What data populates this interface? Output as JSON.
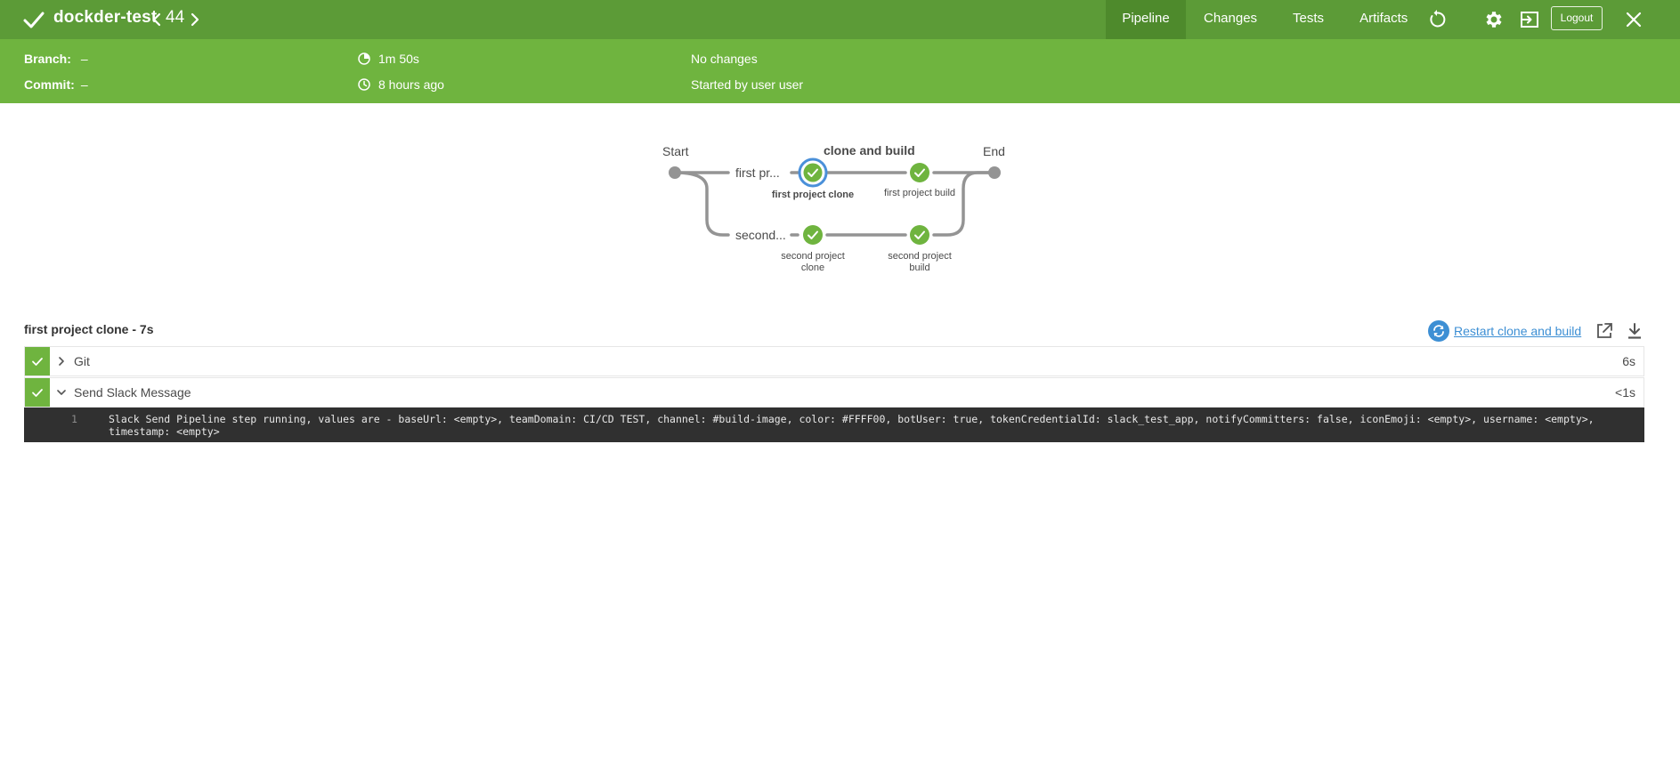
{
  "header": {
    "title": "dockder-test",
    "run_number": "44",
    "tabs": [
      {
        "label": "Pipeline",
        "active": true
      },
      {
        "label": "Changes",
        "active": false
      },
      {
        "label": "Tests",
        "active": false
      },
      {
        "label": "Artifacts",
        "active": false
      }
    ],
    "logout_label": "Logout",
    "colors": {
      "header": "#5c9b37",
      "summary": "#6fb43f",
      "active_tab": "#4e8a2c"
    }
  },
  "summary": {
    "branch_label": "Branch:",
    "branch_value": "–",
    "commit_label": "Commit:",
    "commit_value": "–",
    "duration": "1m 50s",
    "started_ago": "8 hours ago",
    "changes": "No changes",
    "started_by": "Started by user user"
  },
  "graph": {
    "start_label": "Start",
    "end_label": "End",
    "stage_title": "clone and build",
    "branches": [
      {
        "label": "first pr...",
        "steps": [
          {
            "label": "first project clone",
            "selected": true
          },
          {
            "label": "first project build",
            "selected": false
          }
        ]
      },
      {
        "label": "second...",
        "steps": [
          {
            "label": "second project clone",
            "selected": false
          },
          {
            "label": "second project build",
            "selected": false
          }
        ]
      }
    ]
  },
  "detail": {
    "title": "first project clone - 7s",
    "restart_label": "Restart clone and build",
    "steps": [
      {
        "name": "Git",
        "duration": "6s",
        "expanded": false
      },
      {
        "name": "Send Slack Message",
        "duration": "<1s",
        "expanded": true
      }
    ],
    "log": {
      "line_number": "1",
      "text": "Slack Send Pipeline step running, values are - baseUrl: <empty>, teamDomain: CI/CD TEST, channel: #build-image, color: #FFFF00, botUser: true, tokenCredentialId: slack_test_app, notifyCommitters: false, iconEmoji: <empty>, username: <empty>, timestamp: <empty>"
    }
  }
}
